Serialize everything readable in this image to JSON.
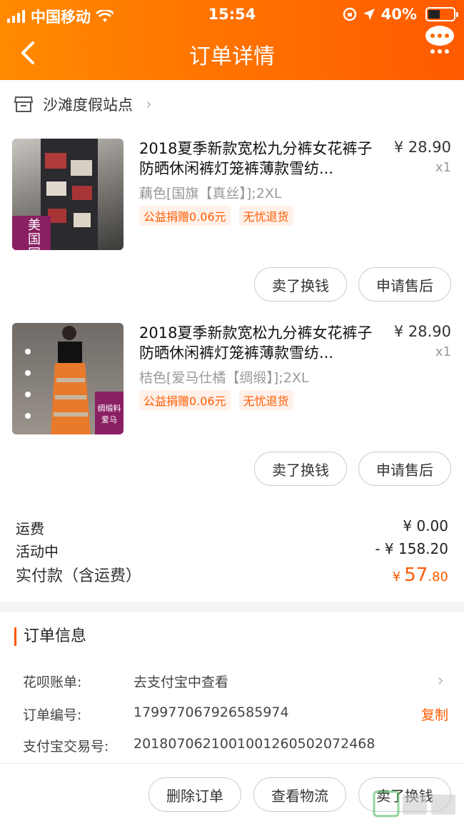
{
  "status_bar": {
    "carrier": "中国移动",
    "time": "15:54",
    "battery": "40%"
  },
  "header": {
    "title": "订单详情"
  },
  "shop": {
    "name": "沙滩度假站点"
  },
  "items": [
    {
      "name": "2018夏季新款宽松九分裤女花裤子防晒休闲裤灯笼裤薄款雪纺...",
      "price": "¥ 28.90",
      "qty": "x1",
      "sku": "藕色[国旗【真丝】];2XL",
      "tags": [
        "公益捐赠0.06元",
        "无忧退货"
      ],
      "thumb_label": "美国国",
      "buttons": [
        "卖了换钱",
        "申请售后"
      ]
    },
    {
      "name": "2018夏季新款宽松九分裤女花裤子防晒休闲裤灯笼裤薄款雪纺...",
      "price": "¥ 28.90",
      "qty": "x1",
      "sku": "桔色[爱马仕橘【绸缎】];2XL",
      "tags": [
        "公益捐赠0.06元",
        "无忧退货"
      ],
      "thumb_label": "绸缎料 爱马",
      "buttons": [
        "卖了换钱",
        "申请售后"
      ]
    }
  ],
  "summary": {
    "shipping_label": "运费",
    "shipping_value": "¥ 0.00",
    "promo_label": "活动中",
    "promo_value": "- ¥ 158.20",
    "total_label": "实付款（含运费）",
    "total_currency": "¥",
    "total_int": "57",
    "total_dec": ".80"
  },
  "order_info": {
    "title": "订单信息",
    "rows": [
      {
        "key": "花呗账单:",
        "value": "去支付宝中查看"
      },
      {
        "key": "订单编号:",
        "value": "179977067926585974",
        "action": "复制"
      },
      {
        "key": "支付宝交易号:",
        "value": "2018070621001001260502072468"
      }
    ]
  },
  "bottom_buttons": [
    "删除订单",
    "查看物流",
    "卖了换钱"
  ],
  "colors": {
    "accent": "#ff5a00",
    "header_start": "#ff8a00"
  }
}
